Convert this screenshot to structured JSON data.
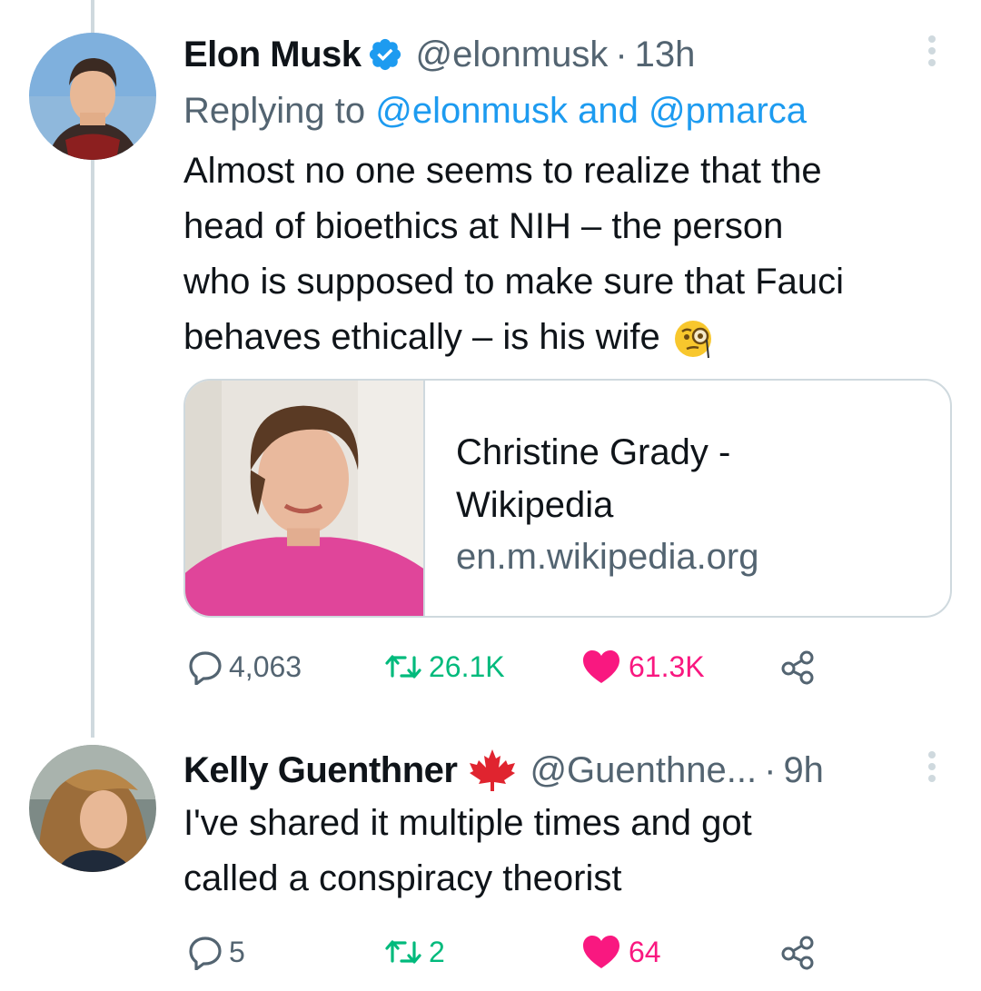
{
  "tweets": [
    {
      "name": "Elon Musk",
      "handle": "@elonmusk",
      "separator": "·",
      "time": "13h",
      "replying_prefix": "Replying to",
      "replying_to_1": "@elonmusk",
      "replying_and": "and",
      "replying_to_2": "@pmarca",
      "text_lines": [
        "Almost no one seems to realize that the",
        "head of bioethics at NIH – the person",
        "who is supposed to make sure that Fauci",
        "behaves ethically – is his wife"
      ],
      "emoji": "face-with-monocle",
      "card": {
        "title_line1": "Christine Grady -",
        "title_line2": "Wikipedia",
        "domain": "en.m.wikipedia.org"
      },
      "replies": "4,063",
      "retweets": "26.1K",
      "likes": "61.3K"
    },
    {
      "name": "Kelly Guenthner",
      "flag": "maple-leaf",
      "handle": "@Guenthne...",
      "separator": "·",
      "time": "9h",
      "text_lines": [
        "I've shared it multiple times and got",
        "called a conspiracy theorist"
      ],
      "replies": "5",
      "retweets": "2",
      "likes": "64"
    }
  ],
  "colors": {
    "accent": "#1d9bf0",
    "retweet": "#00ba7c",
    "like": "#f91880",
    "secondary": "#536471",
    "maple": "#e0242f"
  }
}
